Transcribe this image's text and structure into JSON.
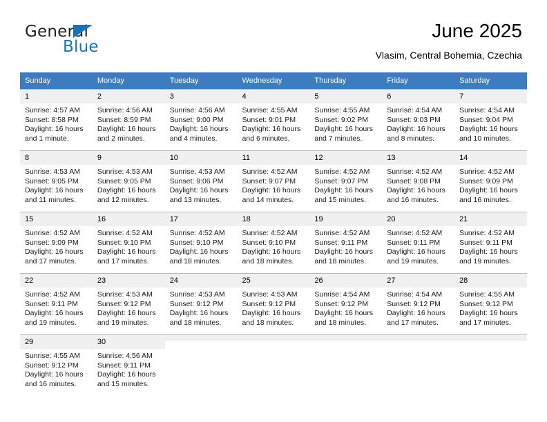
{
  "brand": {
    "name_top": "General",
    "name_bottom": "Blue",
    "accent_color": "#1b72b8"
  },
  "header": {
    "title": "June 2025",
    "location": "Vlasim, Central Bohemia, Czechia"
  },
  "calendar": {
    "header_bg": "#3b7dbf",
    "daynum_bg": "#f0f0f0",
    "weekdays": [
      "Sunday",
      "Monday",
      "Tuesday",
      "Wednesday",
      "Thursday",
      "Friday",
      "Saturday"
    ],
    "weeks": [
      [
        {
          "day": "1",
          "sunrise": "Sunrise: 4:57 AM",
          "sunset": "Sunset: 8:58 PM",
          "daylight": "Daylight: 16 hours and 1 minute."
        },
        {
          "day": "2",
          "sunrise": "Sunrise: 4:56 AM",
          "sunset": "Sunset: 8:59 PM",
          "daylight": "Daylight: 16 hours and 2 minutes."
        },
        {
          "day": "3",
          "sunrise": "Sunrise: 4:56 AM",
          "sunset": "Sunset: 9:00 PM",
          "daylight": "Daylight: 16 hours and 4 minutes."
        },
        {
          "day": "4",
          "sunrise": "Sunrise: 4:55 AM",
          "sunset": "Sunset: 9:01 PM",
          "daylight": "Daylight: 16 hours and 6 minutes."
        },
        {
          "day": "5",
          "sunrise": "Sunrise: 4:55 AM",
          "sunset": "Sunset: 9:02 PM",
          "daylight": "Daylight: 16 hours and 7 minutes."
        },
        {
          "day": "6",
          "sunrise": "Sunrise: 4:54 AM",
          "sunset": "Sunset: 9:03 PM",
          "daylight": "Daylight: 16 hours and 8 minutes."
        },
        {
          "day": "7",
          "sunrise": "Sunrise: 4:54 AM",
          "sunset": "Sunset: 9:04 PM",
          "daylight": "Daylight: 16 hours and 10 minutes."
        }
      ],
      [
        {
          "day": "8",
          "sunrise": "Sunrise: 4:53 AM",
          "sunset": "Sunset: 9:05 PM",
          "daylight": "Daylight: 16 hours and 11 minutes."
        },
        {
          "day": "9",
          "sunrise": "Sunrise: 4:53 AM",
          "sunset": "Sunset: 9:05 PM",
          "daylight": "Daylight: 16 hours and 12 minutes."
        },
        {
          "day": "10",
          "sunrise": "Sunrise: 4:53 AM",
          "sunset": "Sunset: 9:06 PM",
          "daylight": "Daylight: 16 hours and 13 minutes."
        },
        {
          "day": "11",
          "sunrise": "Sunrise: 4:52 AM",
          "sunset": "Sunset: 9:07 PM",
          "daylight": "Daylight: 16 hours and 14 minutes."
        },
        {
          "day": "12",
          "sunrise": "Sunrise: 4:52 AM",
          "sunset": "Sunset: 9:07 PM",
          "daylight": "Daylight: 16 hours and 15 minutes."
        },
        {
          "day": "13",
          "sunrise": "Sunrise: 4:52 AM",
          "sunset": "Sunset: 9:08 PM",
          "daylight": "Daylight: 16 hours and 16 minutes."
        },
        {
          "day": "14",
          "sunrise": "Sunrise: 4:52 AM",
          "sunset": "Sunset: 9:09 PM",
          "daylight": "Daylight: 16 hours and 16 minutes."
        }
      ],
      [
        {
          "day": "15",
          "sunrise": "Sunrise: 4:52 AM",
          "sunset": "Sunset: 9:09 PM",
          "daylight": "Daylight: 16 hours and 17 minutes."
        },
        {
          "day": "16",
          "sunrise": "Sunrise: 4:52 AM",
          "sunset": "Sunset: 9:10 PM",
          "daylight": "Daylight: 16 hours and 17 minutes."
        },
        {
          "day": "17",
          "sunrise": "Sunrise: 4:52 AM",
          "sunset": "Sunset: 9:10 PM",
          "daylight": "Daylight: 16 hours and 18 minutes."
        },
        {
          "day": "18",
          "sunrise": "Sunrise: 4:52 AM",
          "sunset": "Sunset: 9:10 PM",
          "daylight": "Daylight: 16 hours and 18 minutes."
        },
        {
          "day": "19",
          "sunrise": "Sunrise: 4:52 AM",
          "sunset": "Sunset: 9:11 PM",
          "daylight": "Daylight: 16 hours and 18 minutes."
        },
        {
          "day": "20",
          "sunrise": "Sunrise: 4:52 AM",
          "sunset": "Sunset: 9:11 PM",
          "daylight": "Daylight: 16 hours and 19 minutes."
        },
        {
          "day": "21",
          "sunrise": "Sunrise: 4:52 AM",
          "sunset": "Sunset: 9:11 PM",
          "daylight": "Daylight: 16 hours and 19 minutes."
        }
      ],
      [
        {
          "day": "22",
          "sunrise": "Sunrise: 4:52 AM",
          "sunset": "Sunset: 9:11 PM",
          "daylight": "Daylight: 16 hours and 19 minutes."
        },
        {
          "day": "23",
          "sunrise": "Sunrise: 4:53 AM",
          "sunset": "Sunset: 9:12 PM",
          "daylight": "Daylight: 16 hours and 19 minutes."
        },
        {
          "day": "24",
          "sunrise": "Sunrise: 4:53 AM",
          "sunset": "Sunset: 9:12 PM",
          "daylight": "Daylight: 16 hours and 18 minutes."
        },
        {
          "day": "25",
          "sunrise": "Sunrise: 4:53 AM",
          "sunset": "Sunset: 9:12 PM",
          "daylight": "Daylight: 16 hours and 18 minutes."
        },
        {
          "day": "26",
          "sunrise": "Sunrise: 4:54 AM",
          "sunset": "Sunset: 9:12 PM",
          "daylight": "Daylight: 16 hours and 18 minutes."
        },
        {
          "day": "27",
          "sunrise": "Sunrise: 4:54 AM",
          "sunset": "Sunset: 9:12 PM",
          "daylight": "Daylight: 16 hours and 17 minutes."
        },
        {
          "day": "28",
          "sunrise": "Sunrise: 4:55 AM",
          "sunset": "Sunset: 9:12 PM",
          "daylight": "Daylight: 16 hours and 17 minutes."
        }
      ],
      [
        {
          "day": "29",
          "sunrise": "Sunrise: 4:55 AM",
          "sunset": "Sunset: 9:12 PM",
          "daylight": "Daylight: 16 hours and 16 minutes."
        },
        {
          "day": "30",
          "sunrise": "Sunrise: 4:56 AM",
          "sunset": "Sunset: 9:11 PM",
          "daylight": "Daylight: 16 hours and 15 minutes."
        },
        {
          "day": "",
          "sunrise": "",
          "sunset": "",
          "daylight": ""
        },
        {
          "day": "",
          "sunrise": "",
          "sunset": "",
          "daylight": ""
        },
        {
          "day": "",
          "sunrise": "",
          "sunset": "",
          "daylight": ""
        },
        {
          "day": "",
          "sunrise": "",
          "sunset": "",
          "daylight": ""
        },
        {
          "day": "",
          "sunrise": "",
          "sunset": "",
          "daylight": ""
        }
      ]
    ]
  }
}
